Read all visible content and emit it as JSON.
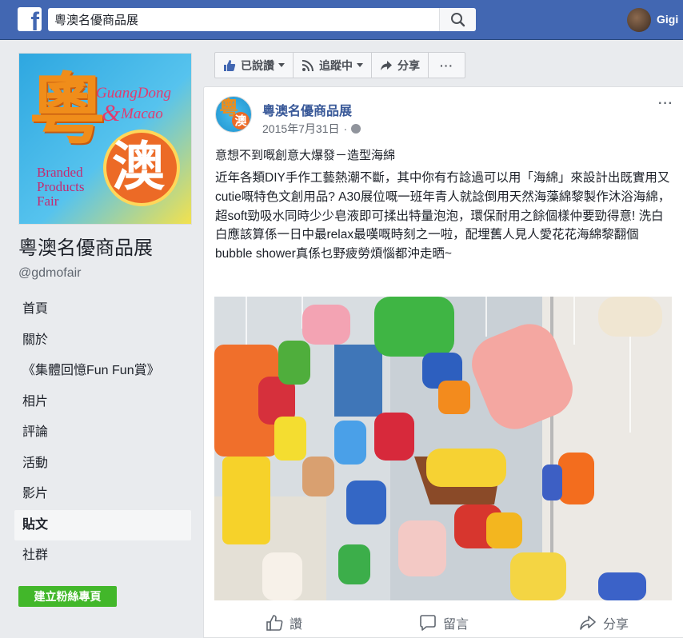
{
  "topbar": {
    "logo_letter": "f",
    "search_value": "粵澳名優商品展",
    "user_name": "Gigi"
  },
  "sidebar": {
    "cover": {
      "big_char": "粵",
      "guangdong": "GuangDong",
      "amp": "&",
      "macao": "Macao",
      "ao_char": "澳",
      "branded_lines": [
        "Branded",
        "Products",
        "Fair"
      ]
    },
    "page_title": "粵澳名優商品展",
    "page_handle": "@gdmofair",
    "nav_items": [
      {
        "label": "首頁"
      },
      {
        "label": "關於"
      },
      {
        "label": "《集體回憶Fun Fun賞》"
      },
      {
        "label": "相片"
      },
      {
        "label": "評論"
      },
      {
        "label": "活動"
      },
      {
        "label": "影片"
      },
      {
        "label": "貼文"
      },
      {
        "label": "社群"
      }
    ],
    "active_item": "貼文",
    "create_button": "建立粉絲專頁"
  },
  "action_bar": {
    "liked": "已說讚",
    "following": "追蹤中",
    "share": "分享",
    "more": "···"
  },
  "post": {
    "author": "粵澳名優商品展",
    "date": "2015年7月31日",
    "dot": "·",
    "more": "···",
    "avatar": {
      "yue": "粵",
      "ao": "澳"
    },
    "headline": "意想不到嘅創意大爆發－造型海綿",
    "body": "近年各類DIY手作工藝熱潮不斷，其中你有冇諗過可以用「海綿」來設計出既實用又cutie嘅特色文創用品? A30展位嘅一班年青人就諗倒用天然海藻綿黎製作沐浴海綿，超soft勁吸水同時少少皂液即可揉出特量泡泡，環保耐用之餘個樣仲要勁得意! 洗白白應該算係一日中最relax最嘆嘅時刻之一啦，配埋舊人見人愛花花海綿黎翻個bubble shower真係乜野疲勞煩惱都沖走晒~",
    "footer": {
      "like": "讚",
      "comment": "留言",
      "share": "分享"
    }
  },
  "colors": {
    "brand_blue": "#4267b2",
    "link_blue": "#385898",
    "create_green": "#42b72a"
  },
  "icons": [
    "facebook-logo-icon",
    "search-icon",
    "thumbs-up-icon",
    "rss-icon",
    "share-arrow-icon",
    "globe-icon",
    "comment-icon",
    "caret-down-icon"
  ]
}
